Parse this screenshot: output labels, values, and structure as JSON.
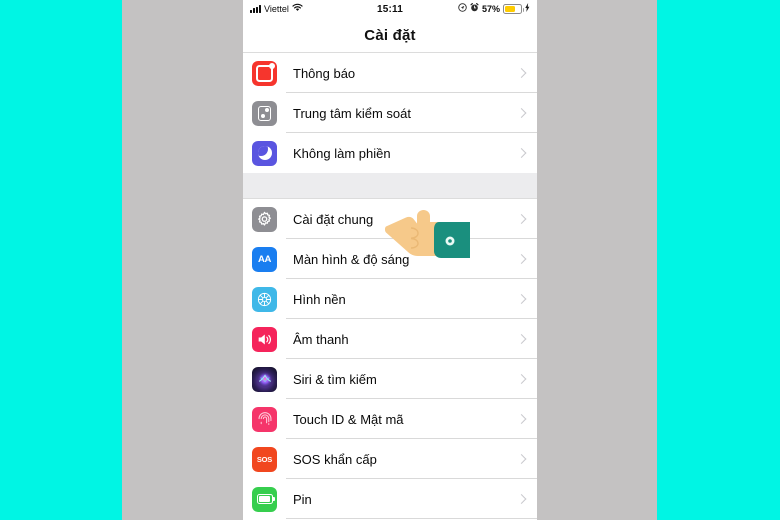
{
  "background": {
    "outer_color": "#00f5e4",
    "band_color": "#c4c2c2"
  },
  "status_bar": {
    "carrier": "Viettel",
    "signal_icon": "signal-bars-icon",
    "wifi_icon": "wifi-icon",
    "time": "15:11",
    "location_icon": "location-arrow-icon",
    "alarm_icon": "alarm-clock-icon",
    "battery_percent": "57%",
    "battery_icon": "battery-icon",
    "battery_fill_color": "#ffcc00",
    "charging_icon": "lightning-bolt-icon"
  },
  "navbar": {
    "title": "Cài đặt"
  },
  "groups": [
    {
      "rows": [
        {
          "label": "Thông báo",
          "icon": "notification-icon",
          "color": "#f6352d",
          "chevron": "chevron-right-icon"
        },
        {
          "label": "Trung tâm kiểm soát",
          "icon": "control-center-icon",
          "color": "#8e8e93",
          "chevron": "chevron-right-icon"
        },
        {
          "label": "Không làm phiền",
          "icon": "do-not-disturb-moon-icon",
          "color": "#5a55e0",
          "chevron": "chevron-right-icon"
        }
      ]
    },
    {
      "rows": [
        {
          "label": "Cài đặt chung",
          "icon": "gear-icon",
          "color": "#8e8e93",
          "chevron": "chevron-right-icon"
        },
        {
          "label": "Màn hình & độ sáng",
          "icon": "display-brightness-aa-icon",
          "color": "#1a7ef0",
          "chevron": "chevron-right-icon"
        },
        {
          "label": "Hình nền",
          "icon": "wallpaper-icon",
          "color": "#3fb8e8",
          "chevron": "chevron-right-icon"
        },
        {
          "label": "Âm thanh",
          "icon": "sound-speaker-icon",
          "color": "#f5245b",
          "chevron": "chevron-right-icon"
        },
        {
          "label": "Siri & tìm kiếm",
          "icon": "siri-icon",
          "color": "#2b1e55",
          "chevron": "chevron-right-icon"
        },
        {
          "label": "Touch ID & Mật mã",
          "icon": "fingerprint-icon",
          "color": "#f5356a",
          "chevron": "chevron-right-icon"
        },
        {
          "label": "SOS khẩn cấp",
          "icon": "sos-icon",
          "color": "#f1471f",
          "chevron": "chevron-right-icon"
        },
        {
          "label": "Pin",
          "icon": "battery-icon",
          "color": "#36ce4e",
          "chevron": "chevron-right-icon"
        }
      ]
    }
  ],
  "overlay": {
    "pointer": {
      "icon": "pointing-hand-cursor-icon",
      "skin_color": "#f6c98a",
      "sleeve_color": "#1a8f7e",
      "points_at": "Cài đặt chung"
    }
  },
  "sos_text": "SOS",
  "aa_text": "AA"
}
